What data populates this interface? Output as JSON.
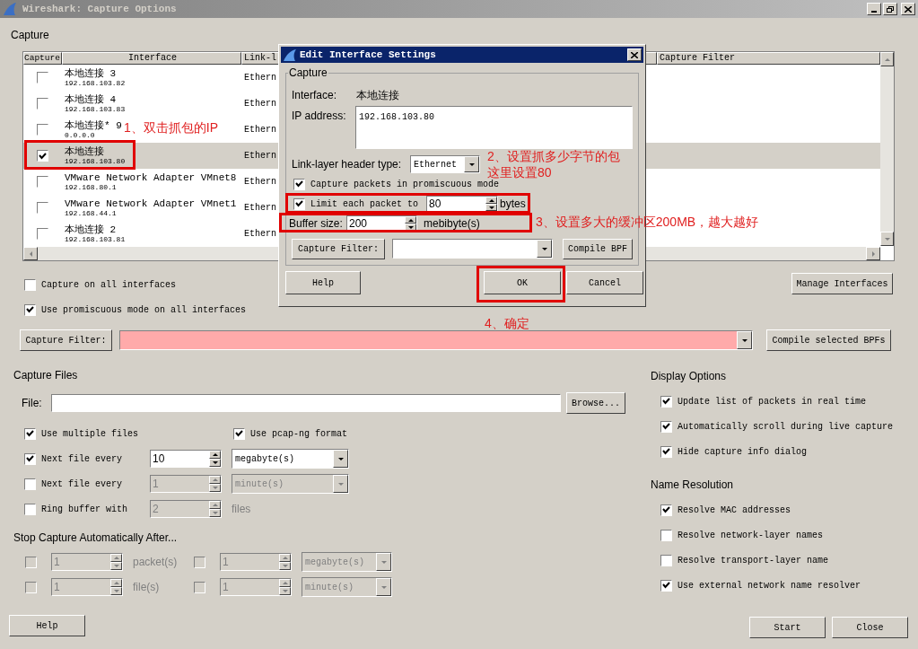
{
  "window": {
    "title": "Wireshark: Capture Options"
  },
  "capture": {
    "group_label": "Capture",
    "table": {
      "columns": [
        "Capture",
        "Interface",
        "Link-l",
        "Capture Filter"
      ],
      "rows": [
        {
          "name": "本地连接 3",
          "address": "192.168.103.82",
          "link": "Ethern",
          "checked": false,
          "selected": false
        },
        {
          "name": "本地连接 4",
          "address": "192.168.103.83",
          "link": "Ethern",
          "checked": false,
          "selected": false
        },
        {
          "name": "本地连接* 9",
          "address": "0.0.0.0",
          "link": "Ethern",
          "checked": false,
          "selected": false
        },
        {
          "name": "本地连接",
          "address": "192.168.103.80",
          "link": "Ethern",
          "checked": true,
          "selected": true
        },
        {
          "name": "VMware Network Adapter VMnet8",
          "address": "192.168.80.1",
          "link": "Ethern",
          "checked": false,
          "selected": false
        },
        {
          "name": "VMware Network Adapter VMnet1",
          "address": "192.168.44.1",
          "link": "Ethern",
          "checked": false,
          "selected": false
        },
        {
          "name": "本地连接 2",
          "address": "192.168.103.81",
          "link": "Ethern",
          "checked": false,
          "selected": false
        }
      ]
    },
    "all_interfaces": {
      "label": "Capture on all interfaces",
      "checked": false
    },
    "promiscuous_all": {
      "label": "Use promiscuous mode on all interfaces",
      "checked": true
    },
    "manage_button": "Manage Interfaces",
    "filter_button": "Capture Filter:",
    "compile_button": "Compile selected BPFs"
  },
  "capture_files": {
    "title": "Capture Files",
    "file_label": "File:",
    "browse_button": "Browse...",
    "multiple": {
      "label": "Use multiple files",
      "checked": true
    },
    "pcapng": {
      "label": "Use pcap-ng format",
      "checked": true
    },
    "rules": [
      {
        "label": "Next file every",
        "checked": true,
        "disabled": false,
        "value": "10",
        "unit": "megabyte(s)",
        "kind": "select"
      },
      {
        "label": "Next file every",
        "checked": false,
        "disabled": true,
        "value": "1",
        "unit": "minute(s)",
        "kind": "select"
      },
      {
        "label": "Ring buffer with",
        "checked": false,
        "disabled": true,
        "value": "2",
        "unit": "files",
        "kind": "text"
      }
    ]
  },
  "stop": {
    "title": "Stop Capture Automatically After...",
    "rows": [
      {
        "items": [
          {
            "checked": false,
            "disabled": true,
            "value": "1",
            "unit": "packet(s)",
            "kind": "text"
          },
          {
            "checked": false,
            "disabled": true,
            "value": "1",
            "unit": "megabyte(s)",
            "kind": "select"
          }
        ]
      },
      {
        "items": [
          {
            "checked": false,
            "disabled": true,
            "value": "1",
            "unit": "file(s)",
            "kind": "text"
          },
          {
            "checked": false,
            "disabled": true,
            "value": "1",
            "unit": "minute(s)",
            "kind": "select"
          }
        ]
      }
    ]
  },
  "display_options": {
    "title": "Display Options",
    "options": [
      {
        "label": "Update list of packets in real time",
        "checked": true
      },
      {
        "label": "Automatically scroll during live capture",
        "checked": true
      },
      {
        "label": "Hide capture info dialog",
        "checked": true
      }
    ]
  },
  "name_resolution": {
    "title": "Name Resolution",
    "options": [
      {
        "label": "Resolve MAC addresses",
        "checked": true
      },
      {
        "label": "Resolve network-layer names",
        "checked": false
      },
      {
        "label": "Resolve transport-layer name",
        "checked": false
      },
      {
        "label": "Use external network name resolver",
        "checked": true
      }
    ]
  },
  "buttons": {
    "help": "Help",
    "start": "Start",
    "close": "Close"
  },
  "dialog": {
    "title": "Edit Interface Settings",
    "group_label": "Capture",
    "interface_label": "Interface:",
    "interface_value": "本地连接",
    "ip_label": "IP address:",
    "ip_value": "192.168.103.80",
    "link_label": "Link-layer header type:",
    "link_value": "Ethernet",
    "promiscuous": {
      "label": "Capture packets in promiscuous mode",
      "checked": true
    },
    "limit": {
      "label": "Limit each packet to",
      "checked": true,
      "value": "80",
      "unit": "bytes"
    },
    "buffer": {
      "label": "Buffer size:",
      "value": "200",
      "unit": "mebibyte(s)"
    },
    "filter_button": "Capture Filter:",
    "compile_button": "Compile BPF",
    "buttons": {
      "help": "Help",
      "ok": "OK",
      "cancel": "Cancel"
    }
  },
  "annotations": [
    {
      "lines": [
        "1、双击抓包的IP"
      ]
    },
    {
      "lines": [
        "2、设置抓多少字节的包",
        "这里设置80"
      ]
    },
    {
      "lines": [
        "3、设置多大的缓冲区200MB，越大越好"
      ]
    },
    {
      "lines": [
        "4、确定"
      ]
    }
  ]
}
